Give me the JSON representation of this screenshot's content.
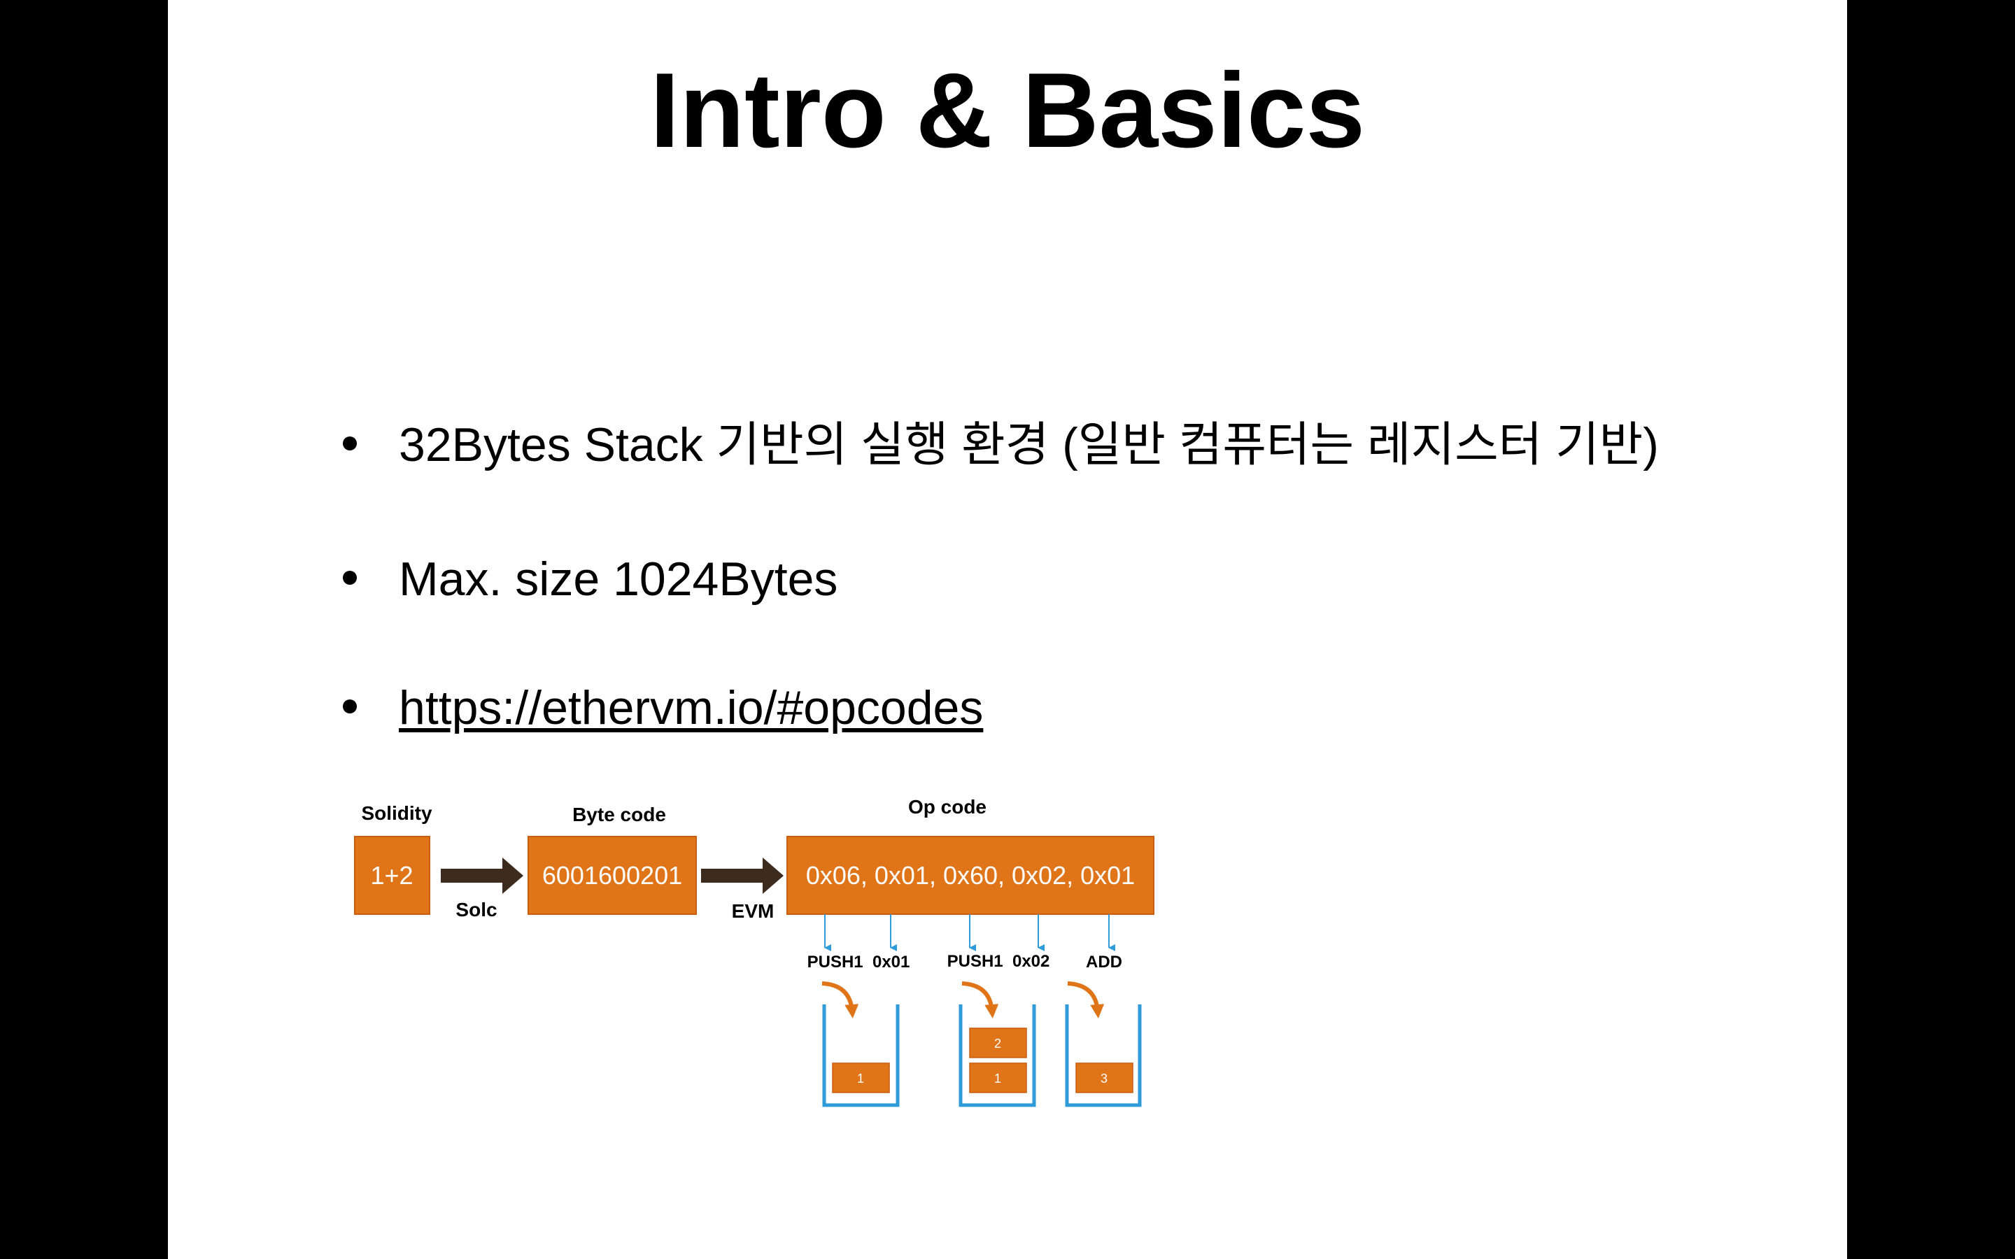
{
  "slide": {
    "title": "Intro & Basics",
    "bullets": [
      {
        "text": "32Bytes Stack 기반의 실행 환경 (일반 컴퓨터는 레지스터 기반)",
        "link": false
      },
      {
        "text": "Max. size 1024Bytes",
        "link": false
      },
      {
        "text": "https://ethervm.io/#opcodes",
        "link": true
      }
    ]
  },
  "diagram": {
    "stages": [
      {
        "label": "Solidity",
        "value": "1+2"
      },
      {
        "label": "Byte code",
        "value": "6001600201"
      },
      {
        "label": "Op code",
        "value": "0x06, 0x01, 0x60, 0x02, 0x01"
      }
    ],
    "arrows": [
      "Solc",
      "EVM"
    ],
    "instructions": [
      "PUSH1  0x01",
      "PUSH1  0x02",
      "ADD"
    ],
    "stacks": [
      {
        "items": [
          "1"
        ]
      },
      {
        "items": [
          "1",
          "2"
        ]
      },
      {
        "items": [
          "3"
        ]
      }
    ]
  },
  "colors": {
    "box": "#e07418",
    "box_border": "#c85f10",
    "arrow": "#3d2c1d",
    "blue": "#2f9bd9",
    "text": "#000000"
  }
}
